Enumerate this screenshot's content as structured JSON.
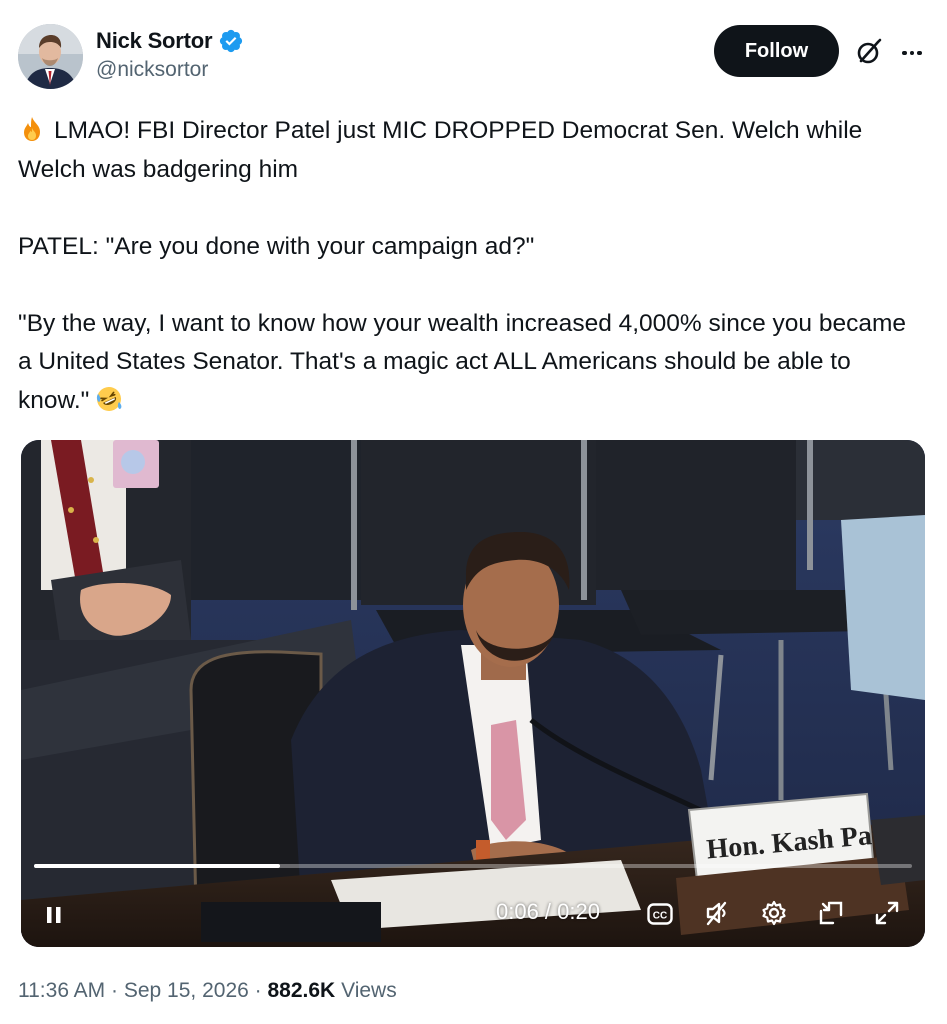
{
  "author": {
    "display_name": "Nick Sortor",
    "handle": "@nicksortor",
    "verified": true
  },
  "actions": {
    "follow_label": "Follow"
  },
  "tweet": {
    "line1": "LMAO! FBI Director Patel just MIC DROPPED Democrat Sen. Welch while Welch was badgering him",
    "line1_emoji": "fire-emoji",
    "line2": "PATEL: \"Are you done with your campaign ad?\"",
    "line3": "\"By the way, I want to know how your wealth increased 4,000% since you became a United States Senator. That's a magic act ALL Americans should be able to know.\"",
    "line3_emoji": "rolling-on-floor-laughing-emoji"
  },
  "video": {
    "nameplate": "Hon. Kash Patel",
    "time_display": "0:06 / 0:20",
    "progress": 0.28,
    "state": "playing",
    "muted": true,
    "controls": [
      "pause-icon",
      "captions-icon",
      "mute-icon",
      "settings-icon",
      "picture-in-picture-icon",
      "fullscreen-icon"
    ]
  },
  "meta": {
    "time": "11:36 AM",
    "separator": "·",
    "date": "Sep 15, 2026",
    "views_count": "882.6K",
    "views_label": "Views"
  },
  "colors": {
    "text": "#0f1419",
    "secondary": "#536471",
    "verified_blue": "#1d9bf0",
    "follow_bg": "#0f1419"
  }
}
